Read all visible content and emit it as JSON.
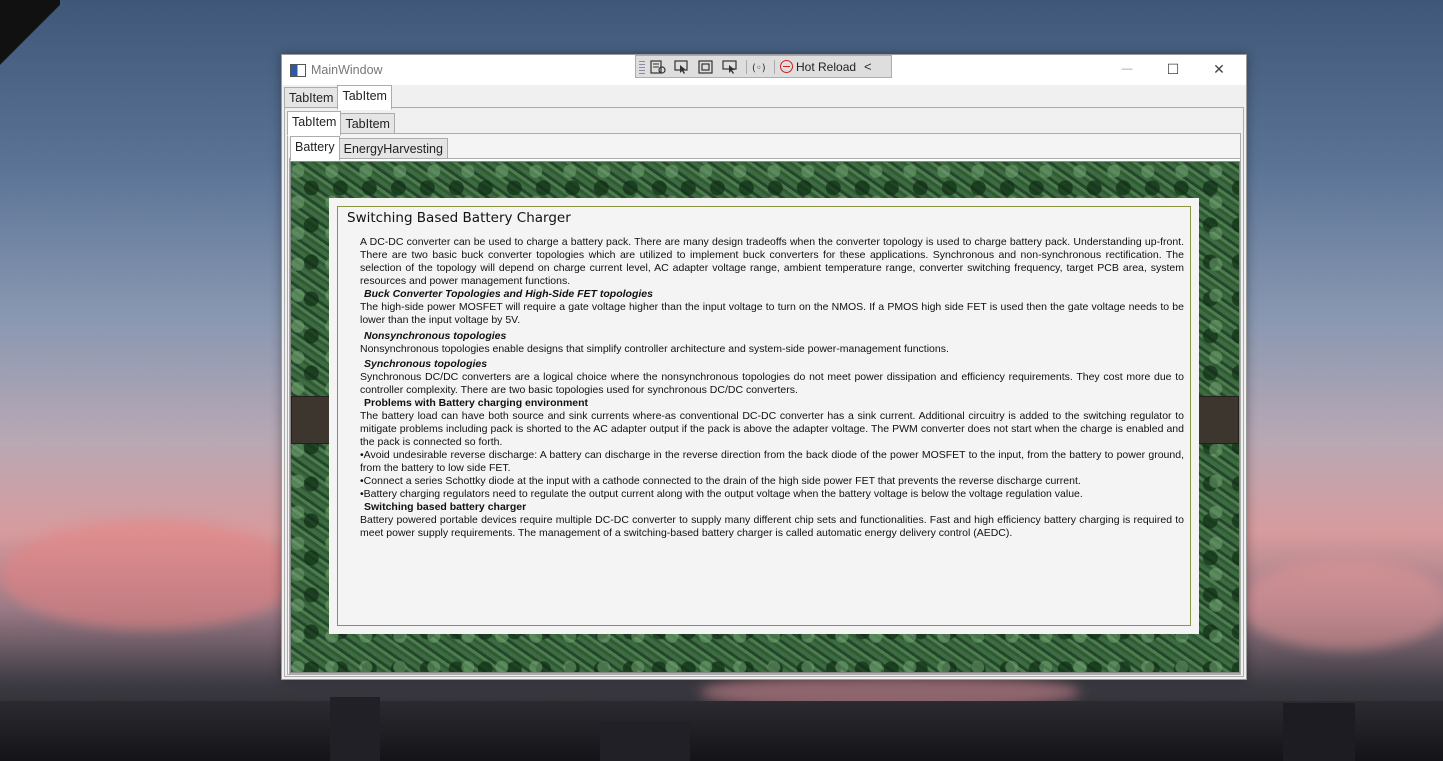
{
  "window": {
    "title": "MainWindow"
  },
  "devbar": {
    "hot_reload_label": "Hot Reload",
    "collapse_glyph": "<"
  },
  "window_controls": {
    "minimize": "—",
    "maximize": "☐",
    "close": "✕"
  },
  "tabs_level1": [
    {
      "label": "TabItem"
    },
    {
      "label": "TabItem"
    }
  ],
  "tabs_level2": [
    {
      "label": "TabItem"
    },
    {
      "label": "TabItem"
    }
  ],
  "tabs_level3": [
    {
      "label": "Battery"
    },
    {
      "label": "EnergyHarvesting"
    }
  ],
  "document": {
    "title": "Switching Based Battery Charger",
    "p1": "A DC-DC converter can be used to charge a battery pack.  There are many design tradeoffs when the converter topology is used to charge battery pack. Understanding up-front. There are two basic buck converter topologies which are utilized to implement buck converters for these applications.  Synchronous and non-synchronous rectification. The selection of the topology will depend on charge current level, AC adapter voltage range, ambient temperature range, converter switching frequency, target PCB area, system resources and power management functions.",
    "h1": "Buck Converter Topologies  and High-Side FET topologies",
    "p2": "The high-side power MOSFET will require a gate voltage higher than the input voltage to turn on the NMOS. If a PMOS high side FET is used then the gate voltage needs to be lower than the input voltage by 5V.",
    "h2": "Nonsynchronous topologies",
    "p3": " Nonsynchronous  topologies enable designs that simplify controller architecture and system-side power-management functions.",
    "h3": "Synchronous topologies",
    "p4": "Synchronous DC/DC converters are a logical choice where the nonsynchronous topologies do not meet power dissipation and efficiency requirements. They cost more due to controller complexity.  There are two basic topologies used for synchronous  DC/DC converters.",
    "h4": "Problems with Battery charging environment",
    "p5": "The battery load can have both source and sink currents where-as conventional DC-DC converter has a sink current. Additional circuitry is added to the switching regulator to mitigate problems including pack is shorted to the AC adapter output if the pack is above the adapter voltage. The PWM converter does not start when the charge is enabled and the pack  is connected so forth.",
    "b1": "•Avoid undesirable reverse discharge: A battery can discharge in the reverse direction from the back diode of the power MOSFET to the input, from the battery to power ground, from the battery to low side FET.",
    "b2": "•Connect a series Schottky diode at the input with a cathode connected to the drain of the high side power FET that prevents the reverse discharge current.",
    "b3": "•Battery charging regulators need to regulate the output current along with the output voltage when the battery voltage is below the voltage regulation value.",
    "h5": "Switching based battery charger",
    "p6": "Battery powered portable devices require multiple DC-DC converter to supply many different chip sets and functionalities.  Fast and high efficiency battery charging is required to meet power supply requirements. The management of a switching-based battery charger is called automatic energy delivery control (AEDC)."
  },
  "colors": {
    "frame_green": "#2f5a33",
    "doc_border": "#8b9540",
    "side_tab": "#3d362e"
  }
}
